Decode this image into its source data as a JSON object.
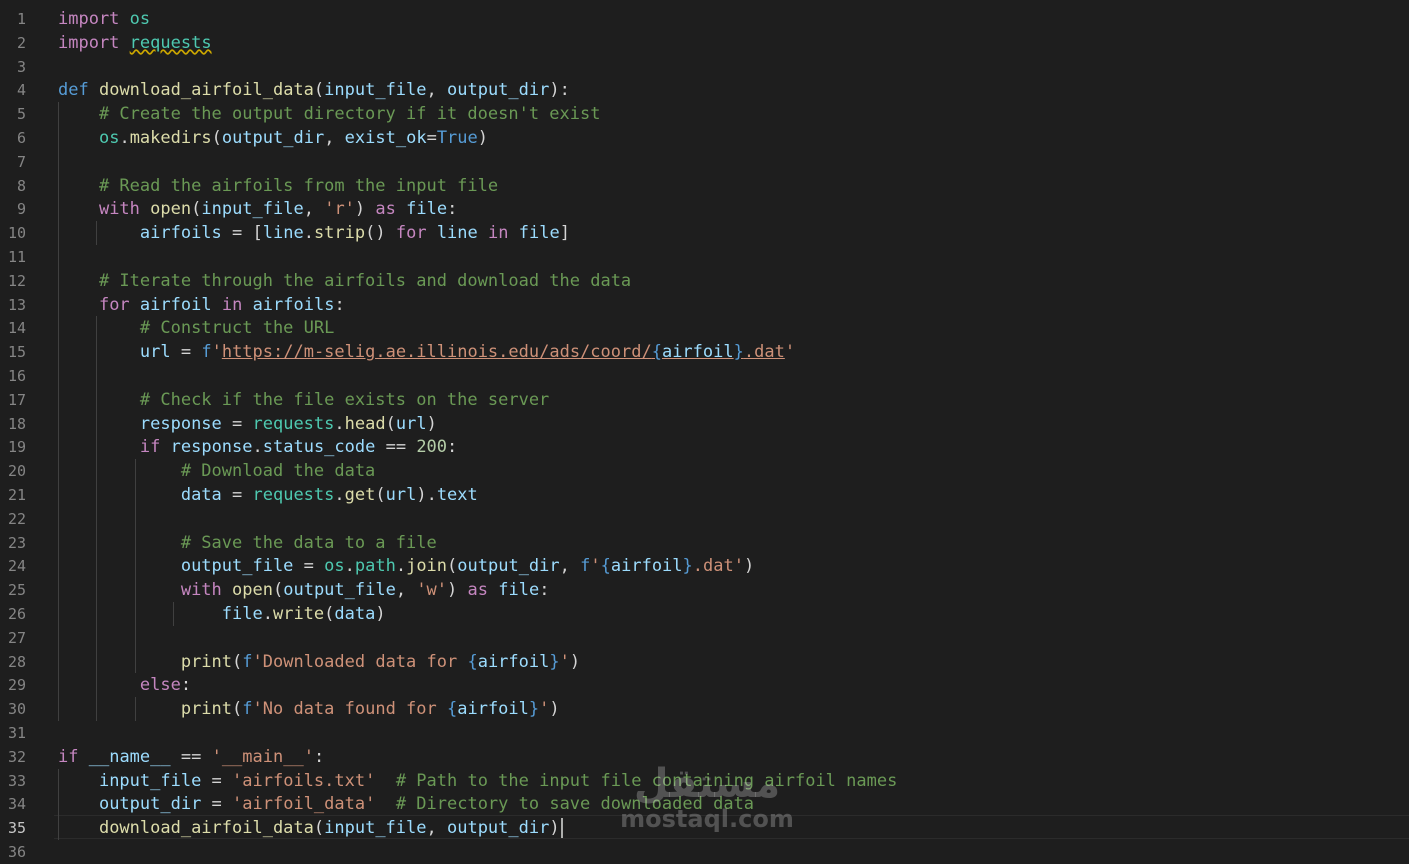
{
  "editor": {
    "active_line": 35,
    "lines": [
      {
        "n": "1",
        "t": [
          [
            "k",
            "import"
          ],
          [
            "p",
            " "
          ],
          [
            "m",
            "os"
          ]
        ]
      },
      {
        "n": "2",
        "t": [
          [
            "k",
            "import"
          ],
          [
            "p",
            " "
          ],
          [
            "m squig",
            "requests"
          ]
        ]
      },
      {
        "n": "3",
        "t": []
      },
      {
        "n": "4",
        "t": [
          [
            "b",
            "def"
          ],
          [
            "p",
            " "
          ],
          [
            "f",
            "download_airfoil_data"
          ],
          [
            "p",
            "("
          ],
          [
            "v",
            "input_file"
          ],
          [
            "p",
            ", "
          ],
          [
            "v",
            "output_dir"
          ],
          [
            "p",
            "):"
          ]
        ]
      },
      {
        "n": "5",
        "t": [
          [
            "p",
            "    "
          ],
          [
            "c",
            "# Create the output directory if it doesn't exist"
          ]
        ]
      },
      {
        "n": "6",
        "t": [
          [
            "p",
            "    "
          ],
          [
            "m",
            "os"
          ],
          [
            "p",
            "."
          ],
          [
            "f",
            "makedirs"
          ],
          [
            "p",
            "("
          ],
          [
            "v",
            "output_dir"
          ],
          [
            "p",
            ", "
          ],
          [
            "v",
            "exist_ok"
          ],
          [
            "p",
            "="
          ],
          [
            "b",
            "True"
          ],
          [
            "p",
            ")"
          ]
        ]
      },
      {
        "n": "7",
        "t": []
      },
      {
        "n": "8",
        "t": [
          [
            "p",
            "    "
          ],
          [
            "c",
            "# Read the airfoils from the input file"
          ]
        ]
      },
      {
        "n": "9",
        "t": [
          [
            "p",
            "    "
          ],
          [
            "k",
            "with"
          ],
          [
            "p",
            " "
          ],
          [
            "f",
            "open"
          ],
          [
            "p",
            "("
          ],
          [
            "v",
            "input_file"
          ],
          [
            "p",
            ", "
          ],
          [
            "s",
            "'r'"
          ],
          [
            "p",
            ") "
          ],
          [
            "k",
            "as"
          ],
          [
            "p",
            " "
          ],
          [
            "v",
            "file"
          ],
          [
            "p",
            ":"
          ]
        ]
      },
      {
        "n": "10",
        "t": [
          [
            "p",
            "        "
          ],
          [
            "v",
            "airfoils"
          ],
          [
            "p",
            " = ["
          ],
          [
            "v",
            "line"
          ],
          [
            "p",
            "."
          ],
          [
            "f",
            "strip"
          ],
          [
            "p",
            "() "
          ],
          [
            "k",
            "for"
          ],
          [
            "p",
            " "
          ],
          [
            "v",
            "line"
          ],
          [
            "p",
            " "
          ],
          [
            "k",
            "in"
          ],
          [
            "p",
            " "
          ],
          [
            "v",
            "file"
          ],
          [
            "p",
            "]"
          ]
        ]
      },
      {
        "n": "11",
        "t": []
      },
      {
        "n": "12",
        "t": [
          [
            "p",
            "    "
          ],
          [
            "c",
            "# Iterate through the airfoils and download the data"
          ]
        ]
      },
      {
        "n": "13",
        "t": [
          [
            "p",
            "    "
          ],
          [
            "k",
            "for"
          ],
          [
            "p",
            " "
          ],
          [
            "v",
            "airfoil"
          ],
          [
            "p",
            " "
          ],
          [
            "k",
            "in"
          ],
          [
            "p",
            " "
          ],
          [
            "v",
            "airfoils"
          ],
          [
            "p",
            ":"
          ]
        ]
      },
      {
        "n": "14",
        "t": [
          [
            "p",
            "        "
          ],
          [
            "c",
            "# Construct the URL"
          ]
        ]
      },
      {
        "n": "15",
        "t": [
          [
            "p",
            "        "
          ],
          [
            "v",
            "url"
          ],
          [
            "p",
            " = "
          ],
          [
            "b",
            "f"
          ],
          [
            "s",
            "'"
          ],
          [
            "s u",
            "https://m-selig.ae.illinois.edu/ads/coord/"
          ],
          [
            "b u",
            "{"
          ],
          [
            "v u",
            "airfoil"
          ],
          [
            "b u",
            "}"
          ],
          [
            "s u",
            ".dat"
          ],
          [
            "s",
            "'"
          ]
        ]
      },
      {
        "n": "16",
        "t": []
      },
      {
        "n": "17",
        "t": [
          [
            "p",
            "        "
          ],
          [
            "c",
            "# Check if the file exists on the server"
          ]
        ]
      },
      {
        "n": "18",
        "t": [
          [
            "p",
            "        "
          ],
          [
            "v",
            "response"
          ],
          [
            "p",
            " = "
          ],
          [
            "m",
            "requests"
          ],
          [
            "p",
            "."
          ],
          [
            "f",
            "head"
          ],
          [
            "p",
            "("
          ],
          [
            "v",
            "url"
          ],
          [
            "p",
            ")"
          ]
        ]
      },
      {
        "n": "19",
        "t": [
          [
            "p",
            "        "
          ],
          [
            "k",
            "if"
          ],
          [
            "p",
            " "
          ],
          [
            "v",
            "response"
          ],
          [
            "p",
            "."
          ],
          [
            "v",
            "status_code"
          ],
          [
            "p",
            " == "
          ],
          [
            "n",
            "200"
          ],
          [
            "p",
            ":"
          ]
        ]
      },
      {
        "n": "20",
        "t": [
          [
            "p",
            "            "
          ],
          [
            "c",
            "# Download the data"
          ]
        ]
      },
      {
        "n": "21",
        "t": [
          [
            "p",
            "            "
          ],
          [
            "v",
            "data"
          ],
          [
            "p",
            " = "
          ],
          [
            "m",
            "requests"
          ],
          [
            "p",
            "."
          ],
          [
            "f",
            "get"
          ],
          [
            "p",
            "("
          ],
          [
            "v",
            "url"
          ],
          [
            "p",
            ")."
          ],
          [
            "v",
            "text"
          ]
        ]
      },
      {
        "n": "22",
        "t": []
      },
      {
        "n": "23",
        "t": [
          [
            "p",
            "            "
          ],
          [
            "c",
            "# Save the data to a file"
          ]
        ]
      },
      {
        "n": "24",
        "t": [
          [
            "p",
            "            "
          ],
          [
            "v",
            "output_file"
          ],
          [
            "p",
            " = "
          ],
          [
            "m",
            "os"
          ],
          [
            "p",
            "."
          ],
          [
            "m",
            "path"
          ],
          [
            "p",
            "."
          ],
          [
            "f",
            "join"
          ],
          [
            "p",
            "("
          ],
          [
            "v",
            "output_dir"
          ],
          [
            "p",
            ", "
          ],
          [
            "b",
            "f"
          ],
          [
            "s",
            "'"
          ],
          [
            "b",
            "{"
          ],
          [
            "v",
            "airfoil"
          ],
          [
            "b",
            "}"
          ],
          [
            "s",
            ".dat'"
          ],
          [
            "p",
            ")"
          ]
        ]
      },
      {
        "n": "25",
        "t": [
          [
            "p",
            "            "
          ],
          [
            "k",
            "with"
          ],
          [
            "p",
            " "
          ],
          [
            "f",
            "open"
          ],
          [
            "p",
            "("
          ],
          [
            "v",
            "output_file"
          ],
          [
            "p",
            ", "
          ],
          [
            "s",
            "'w'"
          ],
          [
            "p",
            ") "
          ],
          [
            "k",
            "as"
          ],
          [
            "p",
            " "
          ],
          [
            "v",
            "file"
          ],
          [
            "p",
            ":"
          ]
        ]
      },
      {
        "n": "26",
        "t": [
          [
            "p",
            "                "
          ],
          [
            "v",
            "file"
          ],
          [
            "p",
            "."
          ],
          [
            "f",
            "write"
          ],
          [
            "p",
            "("
          ],
          [
            "v",
            "data"
          ],
          [
            "p",
            ")"
          ]
        ]
      },
      {
        "n": "27",
        "t": []
      },
      {
        "n": "28",
        "t": [
          [
            "p",
            "            "
          ],
          [
            "f",
            "print"
          ],
          [
            "p",
            "("
          ],
          [
            "b",
            "f"
          ],
          [
            "s",
            "'Downloaded data for "
          ],
          [
            "b",
            "{"
          ],
          [
            "v",
            "airfoil"
          ],
          [
            "b",
            "}"
          ],
          [
            "s",
            "'"
          ],
          [
            "p",
            ")"
          ]
        ]
      },
      {
        "n": "29",
        "t": [
          [
            "p",
            "        "
          ],
          [
            "k",
            "else"
          ],
          [
            "p",
            ":"
          ]
        ]
      },
      {
        "n": "30",
        "t": [
          [
            "p",
            "            "
          ],
          [
            "f",
            "print"
          ],
          [
            "p",
            "("
          ],
          [
            "b",
            "f"
          ],
          [
            "s",
            "'No data found for "
          ],
          [
            "b",
            "{"
          ],
          [
            "v",
            "airfoil"
          ],
          [
            "b",
            "}"
          ],
          [
            "s",
            "'"
          ],
          [
            "p",
            ")"
          ]
        ]
      },
      {
        "n": "31",
        "t": []
      },
      {
        "n": "32",
        "t": [
          [
            "k",
            "if"
          ],
          [
            "p",
            " "
          ],
          [
            "v",
            "__name__"
          ],
          [
            "p",
            " == "
          ],
          [
            "s",
            "'__main__'"
          ],
          [
            "p",
            ":"
          ]
        ]
      },
      {
        "n": "33",
        "t": [
          [
            "p",
            "    "
          ],
          [
            "v",
            "input_file"
          ],
          [
            "p",
            " = "
          ],
          [
            "s",
            "'airfoils.txt'"
          ],
          [
            "p",
            "  "
          ],
          [
            "c",
            "# Path to the input file containing airfoil names"
          ]
        ]
      },
      {
        "n": "34",
        "t": [
          [
            "p",
            "    "
          ],
          [
            "v",
            "output_dir"
          ],
          [
            "p",
            " = "
          ],
          [
            "s",
            "'airfoil_data'"
          ],
          [
            "p",
            "  "
          ],
          [
            "c",
            "# Directory to save downloaded data"
          ]
        ]
      },
      {
        "n": "35",
        "t": [
          [
            "p",
            "    "
          ],
          [
            "f",
            "download_airfoil_data"
          ],
          [
            "p",
            "("
          ],
          [
            "v",
            "input_file"
          ],
          [
            "p",
            ", "
          ],
          [
            "v",
            "output_dir"
          ],
          [
            "p",
            ")"
          ]
        ]
      },
      {
        "n": "36",
        "t": []
      }
    ]
  },
  "watermark": {
    "arabic": "مستقل",
    "latin": "mostaql.com"
  }
}
